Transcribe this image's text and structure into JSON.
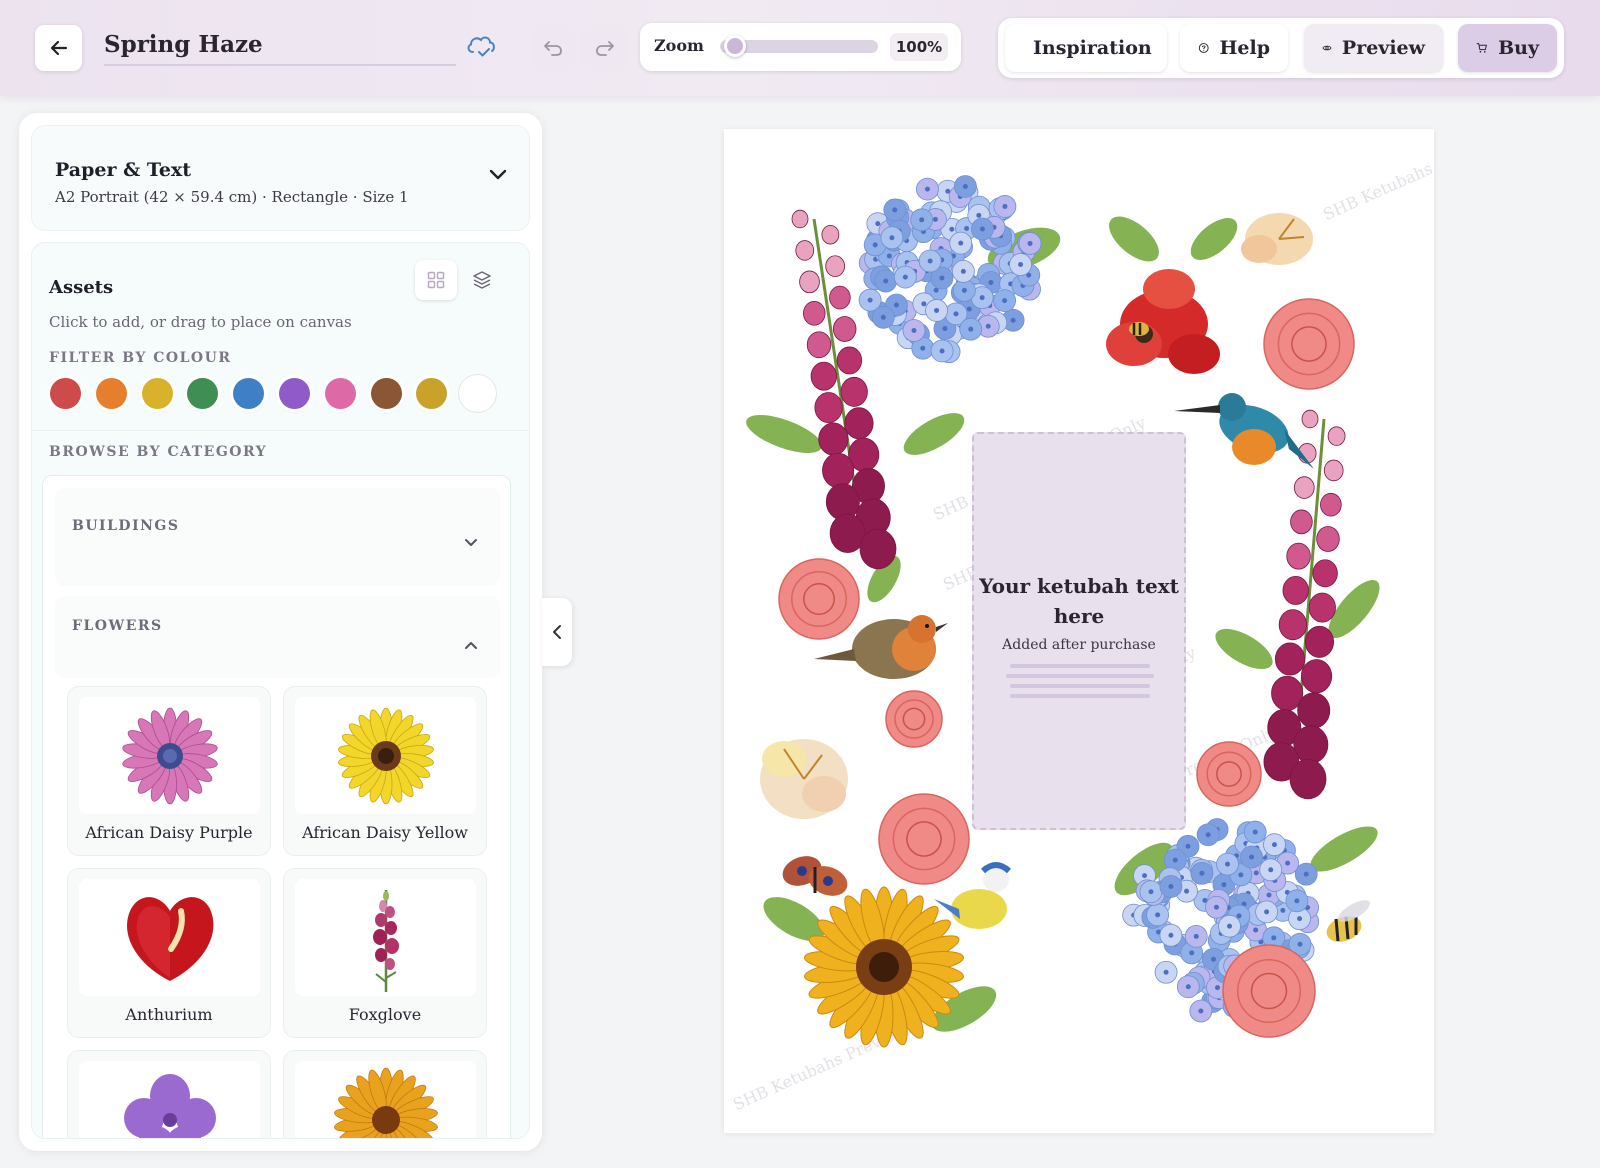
{
  "header": {
    "title": "Spring Haze",
    "zoom_label": "Zoom",
    "zoom_value": "100%",
    "zoom_level": 0.1,
    "actions": {
      "inspiration": "Inspiration",
      "help": "Help",
      "preview": "Preview",
      "buy": "Buy"
    }
  },
  "paper": {
    "title": "Paper & Text",
    "subtitle": "A2 Portrait (42 × 59.4 cm) · Rectangle · Size 1"
  },
  "assets": {
    "title": "Assets",
    "subtitle": "Click to add, or drag to place on canvas",
    "filter_label": "FILTER BY COLOUR",
    "colours": [
      "#cf4a4a",
      "#e57f2e",
      "#d9b22c",
      "#3f8f55",
      "#3f7fc5",
      "#8e5bc9",
      "#dd6aa6",
      "#8a5636",
      "#c9a22a",
      "#ffffff"
    ],
    "browse_label": "BROWSE BY CATEGORY",
    "categories": [
      {
        "name": "BUILDINGS"
      },
      {
        "name": "FLOWERS"
      }
    ],
    "items": [
      {
        "name": "African Daisy Purple",
        "icon": "purple-daisy-icon"
      },
      {
        "name": "African Daisy Yellow",
        "icon": "yellow-daisy-icon"
      },
      {
        "name": "Anthurium",
        "icon": "anthurium-icon"
      },
      {
        "name": "Foxglove",
        "icon": "foxglove-icon"
      }
    ]
  },
  "canvas": {
    "text_main": "Your ketubah text here",
    "text_sub": "Added after purchase",
    "watermark": "SHB Ketubahs Preview Only"
  }
}
